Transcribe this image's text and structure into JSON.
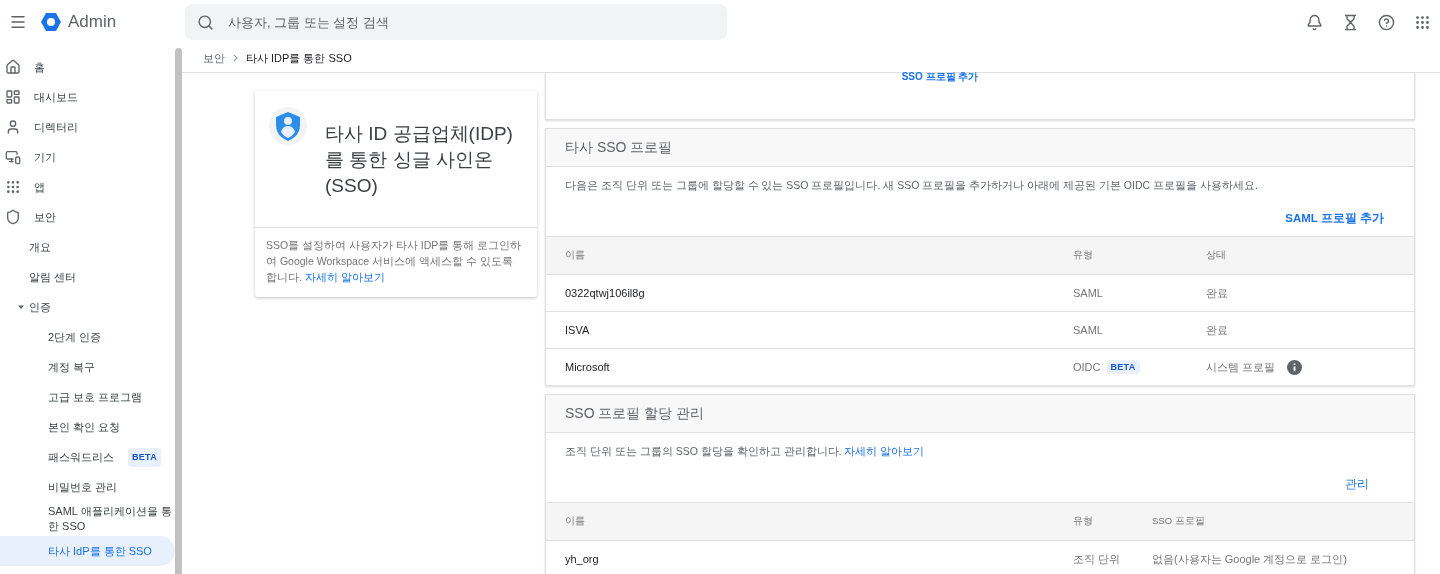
{
  "header": {
    "app_name": "Admin",
    "search_placeholder": "사용자, 그룹 또는 설정 검색"
  },
  "sidebar": {
    "items": [
      {
        "label": "홈",
        "selected": false
      },
      {
        "label": "대시보드",
        "selected": false
      },
      {
        "label": "디렉터리",
        "selected": false
      },
      {
        "label": "기기",
        "selected": false
      },
      {
        "label": "앱",
        "selected": false
      },
      {
        "label": "보안",
        "selected": false,
        "children": [
          {
            "label": "개요",
            "selected": false
          },
          {
            "label": "알림 센터",
            "selected": false
          },
          {
            "label": "인증",
            "selected": false,
            "expanded": true,
            "children": [
              {
                "label": "2단계 인증",
                "selected": false
              },
              {
                "label": "계정 복구",
                "selected": false
              },
              {
                "label": "고급 보호 프로그램",
                "selected": false
              },
              {
                "label": "본인 확인 요청",
                "selected": false
              },
              {
                "label": "패스워드리스",
                "selected": false,
                "badge": "BETA"
              },
              {
                "label": "비밀번호 관리",
                "selected": false
              },
              {
                "label": "SAML 애플리케이션을 통한 SSO",
                "selected": false
              },
              {
                "label": "타사 IdP를 통한 SSO",
                "selected": true
              }
            ]
          }
        ]
      }
    ]
  },
  "breadcrumb": [
    "보안",
    "타사 IDP를 통한 SSO"
  ],
  "info_card": {
    "title": "타사 ID 공급업체(IDP)를 통한 싱글 사인온(SSO)",
    "description": "SSO를 설정하여 사용자가 타사 IDP를 통해 로그인하여 Google Workspace 서비스에 액세스할 수 있도록 합니다.",
    "link": "자세히 알아보기"
  },
  "top_card": {
    "link": "SSO 프로필 추가"
  },
  "profiles": {
    "title": "타사 SSO 프로필",
    "description": "다음은 조직 단위 또는 그룹에 할당할 수 있는 SSO 프로필입니다. 새 SSO 프로필을 추가하거나 아래에 제공된 기본 OIDC 프로필을 사용하세요.",
    "action": "SAML 프로필 추가",
    "columns": [
      "이름",
      "유형",
      "상태"
    ],
    "rows": [
      {
        "name": "0322qtwj106il8g",
        "type": "SAML",
        "status": "완료",
        "info": false
      },
      {
        "name": "ISVA",
        "type": "SAML",
        "status": "완료",
        "info": false
      },
      {
        "name": "Microsoft",
        "type": "OIDC",
        "badge": "BETA",
        "status": "시스템 프로필",
        "info": true
      }
    ]
  },
  "assignments": {
    "title": "SSO 프로필 할당 관리",
    "description": "조직 단위 또는 그룹의 SSO 할당을 확인하고 관리합니다.",
    "link": "자세히 알아보기",
    "action": "관리",
    "columns": [
      "이름",
      "유형",
      "SSO 프로필"
    ],
    "rows": [
      {
        "name": "yh_org",
        "type": "조직 단위",
        "profile": "없음(사용자는 Google 계정으로 로그인)"
      }
    ]
  }
}
